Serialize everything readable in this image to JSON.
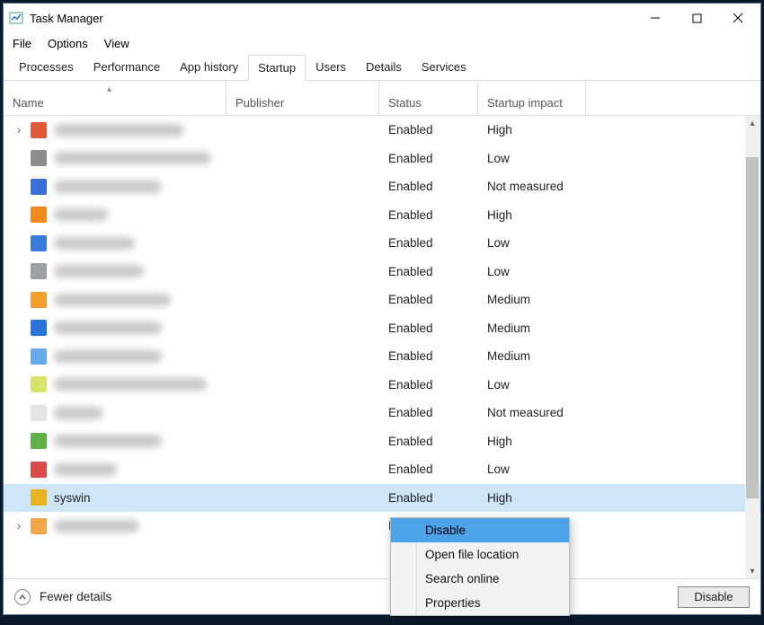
{
  "window": {
    "title": "Task Manager"
  },
  "menu": {
    "file": "File",
    "options": "Options",
    "view": "View"
  },
  "tabs": {
    "processes": "Processes",
    "performance": "Performance",
    "app_history": "App history",
    "startup": "Startup",
    "users": "Users",
    "details": "Details",
    "services": "Services"
  },
  "columns": {
    "name": "Name",
    "publisher": "Publisher",
    "status": "Status",
    "impact": "Startup impact"
  },
  "rows": [
    {
      "expand": true,
      "icon": "#e05a3c",
      "status": "Enabled",
      "impact": "High",
      "name_w": 145,
      "pub_w": 65
    },
    {
      "expand": false,
      "icon": "#8c8c8c",
      "status": "Enabled",
      "impact": "Low",
      "name_w": 175,
      "pub_w": 150
    },
    {
      "expand": false,
      "icon": "#3a6fd8",
      "status": "Enabled",
      "impact": "Not measured",
      "name_w": 120,
      "pub_w": 0
    },
    {
      "expand": false,
      "icon": "#f08a1e",
      "status": "Enabled",
      "impact": "High",
      "name_w": 60,
      "pub_w": 0
    },
    {
      "expand": false,
      "icon": "#3b7ad6",
      "status": "Enabled",
      "impact": "Low",
      "name_w": 90,
      "pub_w": 100
    },
    {
      "expand": false,
      "icon": "#9aa0a6",
      "status": "Enabled",
      "impact": "Low",
      "name_w": 100,
      "pub_w": 100
    },
    {
      "expand": false,
      "icon": "#f0a030",
      "status": "Enabled",
      "impact": "Medium",
      "name_w": 130,
      "pub_w": 110
    },
    {
      "expand": false,
      "icon": "#2b73d6",
      "status": "Enabled",
      "impact": "Medium",
      "name_w": 120,
      "pub_w": 125
    },
    {
      "expand": false,
      "icon": "#6aa9e9",
      "status": "Enabled",
      "impact": "Medium",
      "name_w": 120,
      "pub_w": 95
    },
    {
      "expand": false,
      "icon": "#d9e26a",
      "status": "Enabled",
      "impact": "Low",
      "name_w": 170,
      "pub_w": 115
    },
    {
      "expand": false,
      "icon": "#e5e5e5",
      "status": "Enabled",
      "impact": "Not measured",
      "name_w": 55,
      "pub_w": 0
    },
    {
      "expand": false,
      "icon": "#62b04a",
      "status": "Enabled",
      "impact": "High",
      "name_w": 120,
      "pub_w": 125
    },
    {
      "expand": false,
      "icon": "#d94a4a",
      "status": "Enabled",
      "impact": "Low",
      "name_w": 70,
      "pub_w": 125
    },
    {
      "expand": false,
      "icon": "#e8b422",
      "status": "Enabled",
      "impact": "High",
      "name_w": 0,
      "pub_w": 0,
      "name": "syswin",
      "selected": true
    },
    {
      "expand": true,
      "icon": "#f0a64a",
      "status": "E",
      "impact": "",
      "name_w": 95,
      "pub_w": 0
    }
  ],
  "context_menu": {
    "disable": "Disable",
    "open_location": "Open file location",
    "search_online": "Search online",
    "properties": "Properties"
  },
  "footer": {
    "fewer": "Fewer details",
    "disable_btn": "Disable"
  }
}
